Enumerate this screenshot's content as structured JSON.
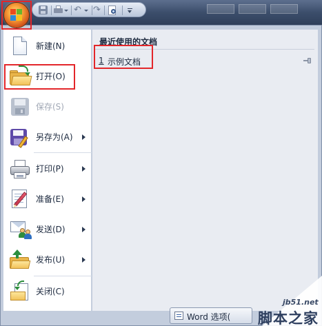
{
  "quick_access": {
    "items": [
      {
        "name": "save"
      },
      {
        "name": "quick-print"
      },
      {
        "name": "undo",
        "glyph": "↶"
      },
      {
        "name": "redo",
        "glyph": "↷"
      },
      {
        "name": "print-preview"
      },
      {
        "name": "customize"
      }
    ]
  },
  "menu": {
    "commands": [
      {
        "id": "new",
        "label": "新建(N)",
        "icon": "new-document-icon",
        "enabled": true,
        "submenu": false
      },
      {
        "id": "open",
        "label": "打开(O)",
        "icon": "open-folder-icon",
        "enabled": true,
        "submenu": false
      },
      {
        "id": "save",
        "label": "保存(S)",
        "icon": "save-disk-icon",
        "enabled": false,
        "submenu": false
      },
      {
        "id": "save-as",
        "label": "另存为(A)",
        "icon": "save-as-icon",
        "enabled": true,
        "submenu": true
      },
      {
        "id": "print",
        "label": "打印(P)",
        "icon": "printer-icon",
        "enabled": true,
        "submenu": true
      },
      {
        "id": "prepare",
        "label": "准备(E)",
        "icon": "prepare-icon",
        "enabled": true,
        "submenu": true
      },
      {
        "id": "send",
        "label": "发送(D)",
        "icon": "send-icon",
        "enabled": true,
        "submenu": true
      },
      {
        "id": "publish",
        "label": "发布(U)",
        "icon": "publish-icon",
        "enabled": true,
        "submenu": true
      },
      {
        "id": "close",
        "label": "关闭(C)",
        "icon": "close-document-icon",
        "enabled": true,
        "submenu": false
      }
    ]
  },
  "recent": {
    "title": "最近使用的文档",
    "items": [
      {
        "number": "1",
        "name": "示例文档"
      }
    ]
  },
  "footer": {
    "options_label": "Word 选项("
  },
  "watermark": {
    "site": "jb51.net",
    "name": "脚本之家"
  },
  "colors": {
    "highlight": "#e3262a",
    "menu_background": "#c3cddd",
    "recent_background": "#e9ecf2"
  }
}
